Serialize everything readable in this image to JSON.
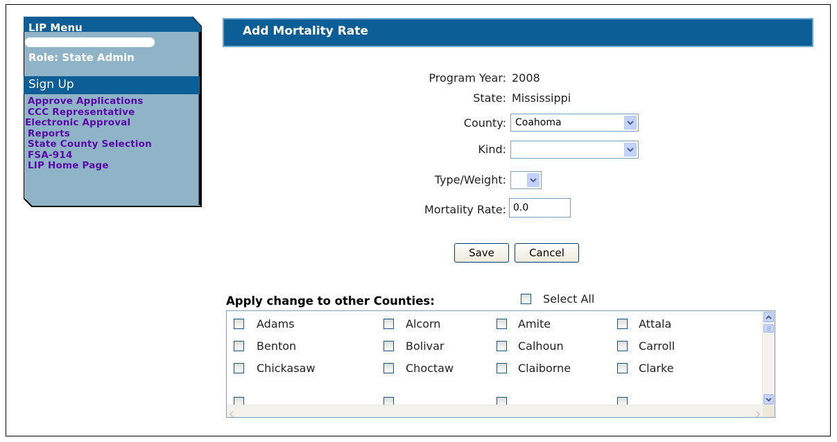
{
  "sidebar": {
    "title": "LIP Menu",
    "role": "Role: State Admin",
    "section": "Sign Up",
    "links": [
      "Approve Applications",
      "CCC Representative",
      "Electronic Approval",
      "Reports",
      "State County Selection",
      "FSA-914",
      "LIP Home Page"
    ]
  },
  "page": {
    "title": "Add Mortality Rate"
  },
  "form": {
    "program_year_label": "Program Year:",
    "program_year": "2008",
    "state_label": "State:",
    "state": "Mississippi",
    "county_label": "County:",
    "county": "Coahoma",
    "kind_label": "Kind:",
    "kind": "",
    "type_weight_label": "Type/Weight:",
    "type_weight": "",
    "mortality_label": "Mortality Rate:",
    "mortality": "0.0"
  },
  "buttons": {
    "save": "Save",
    "cancel": "Cancel"
  },
  "apply": {
    "label": "Apply change to other Counties:",
    "select_all": "Select All",
    "counties": [
      [
        "Adams",
        "Alcorn",
        "Amite",
        "Attala"
      ],
      [
        "Benton",
        "Bolivar",
        "Calhoun",
        "Carroll"
      ],
      [
        "Chickasaw",
        "Choctaw",
        "Claiborne",
        "Clarke"
      ]
    ]
  },
  "colors": {
    "header_blue": "#0b5f96",
    "sidebar_bg": "#8fb4c8",
    "link_purple": "#5a0aa8"
  }
}
